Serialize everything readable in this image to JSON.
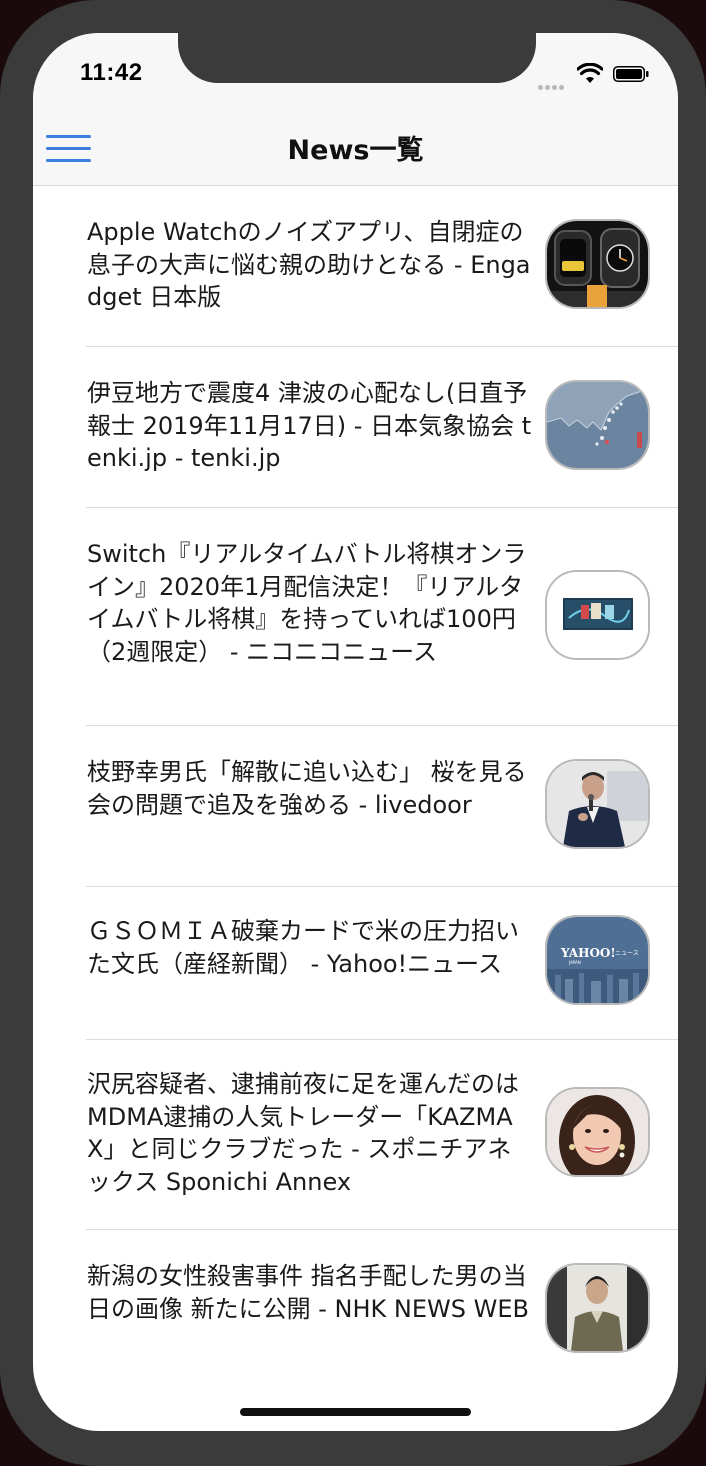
{
  "status_bar": {
    "time": "11:42"
  },
  "navbar": {
    "title": "News一覧",
    "menu_icon": "hamburger-menu-icon",
    "accent_color": "#3b7fde"
  },
  "news": [
    {
      "title": "Apple Watchのノイズアプリ、自閉症の息子の大声に悩む親の助けとなる - Engadget 日本版",
      "thumbnail": "apple-watch-thumbnail"
    },
    {
      "title": "伊豆地方で震度4 津波の心配なし(日直予報士 2019年11月17日) - 日本気象協会 tenki.jp - tenki.jp",
      "thumbnail": "earthquake-map-thumbnail"
    },
    {
      "title": "Switch『リアルタイムバトル将棋オンライン』2020年1月配信決定！『リアルタイムバトル将棋』を持っていれば100円（2週限定） - ニコニコニュース",
      "thumbnail": "shogi-game-thumbnail"
    },
    {
      "title": "枝野幸男氏「解散に追い込む」 桜を見る会の問題で追及を強める - livedoor",
      "thumbnail": "speaker-photo-thumbnail"
    },
    {
      "title": "ＧＳＯＭＩＡ破棄カードで米の圧力招いた文氏（産経新聞） - Yahoo!ニュース",
      "thumbnail": "yahoo-news-thumbnail"
    },
    {
      "title": "沢尻容疑者、逮捕前夜に足を運んだのは MDMA逮捕の人気トレーダー「KAZMAX」と同じクラブだった - スポニチアネックス Sponichi Annex",
      "thumbnail": "woman-portrait-thumbnail"
    },
    {
      "title": "新潟の女性殺害事件 指名手配した男の当日の画像 新たに公開 - NHK NEWS WEB",
      "thumbnail": "man-photo-thumbnail"
    }
  ]
}
